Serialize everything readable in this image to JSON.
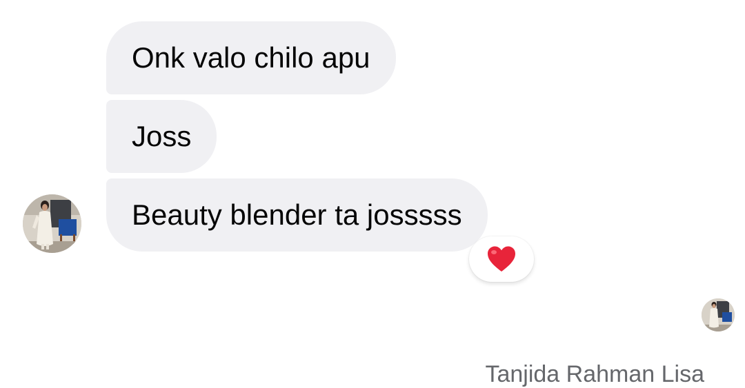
{
  "messages": [
    {
      "text": "Onk valo chilo apu"
    },
    {
      "text": "Joss"
    },
    {
      "text": "Beauty blender ta josssss",
      "reaction": "heart-emoji"
    }
  ],
  "colors": {
    "bubble_bg": "#f0f0f3",
    "text": "#050505",
    "name_text": "#65676b",
    "heart": "#e8243a"
  },
  "sender": {
    "avatar_icon": "profile-photo",
    "seen_avatar_icon": "seen-receipt-avatar"
  },
  "footer": {
    "name": "Tanjida Rahman Lisa"
  }
}
